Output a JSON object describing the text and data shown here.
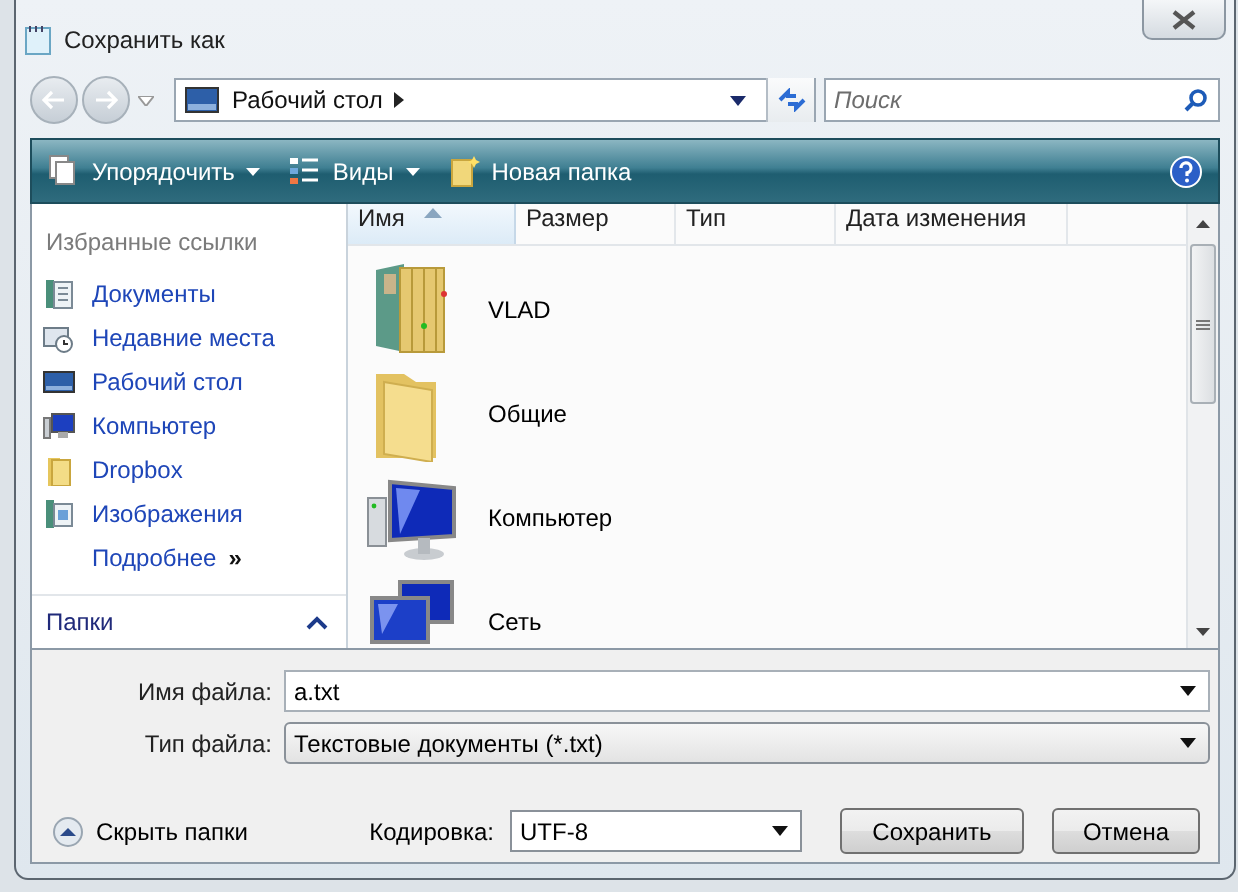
{
  "window": {
    "title": "Сохранить как"
  },
  "nav": {
    "address": "Рабочий стол",
    "search_placeholder": "Поиск"
  },
  "toolbar": [
    {
      "label": "Упорядочить",
      "kind": "organize",
      "dropdown": true
    },
    {
      "label": "Виды",
      "kind": "views",
      "dropdown": true
    },
    {
      "label": "Новая папка",
      "kind": "new-folder",
      "dropdown": false
    }
  ],
  "sidebar": {
    "heading": "Избранные ссылки",
    "links": [
      {
        "label": "Документы",
        "kind": "documents"
      },
      {
        "label": "Недавние места",
        "kind": "recent"
      },
      {
        "label": "Рабочий стол",
        "kind": "desktop"
      },
      {
        "label": "Компьютер",
        "kind": "computer"
      },
      {
        "label": "Dropbox",
        "kind": "folder"
      },
      {
        "label": "Изображения",
        "kind": "pictures"
      }
    ],
    "more": "Подробнее",
    "more_glyph": "»",
    "folders": "Папки",
    "folders_expanded": false
  },
  "files": {
    "columns": [
      {
        "label": "Имя",
        "sorted": true
      },
      {
        "label": "Размер",
        "sorted": false
      },
      {
        "label": "Тип",
        "sorted": false
      },
      {
        "label": "Дата изменения",
        "sorted": false
      }
    ],
    "items": [
      {
        "name": "VLAD",
        "kind": "library"
      },
      {
        "name": "Общие",
        "kind": "folder"
      },
      {
        "name": "Компьютер",
        "kind": "computer"
      },
      {
        "name": "Сеть",
        "kind": "network"
      }
    ]
  },
  "form": {
    "filename": {
      "label": "Имя файла:",
      "value": "a.txt"
    },
    "filetype": {
      "label": "Тип файла:",
      "value": "Текстовые документы (*.txt)"
    },
    "hide_folders": "Скрыть папки",
    "encoding": {
      "label": "Кодировка:",
      "value": "UTF-8"
    },
    "buttons": [
      "Сохранить",
      "Отмена"
    ]
  }
}
